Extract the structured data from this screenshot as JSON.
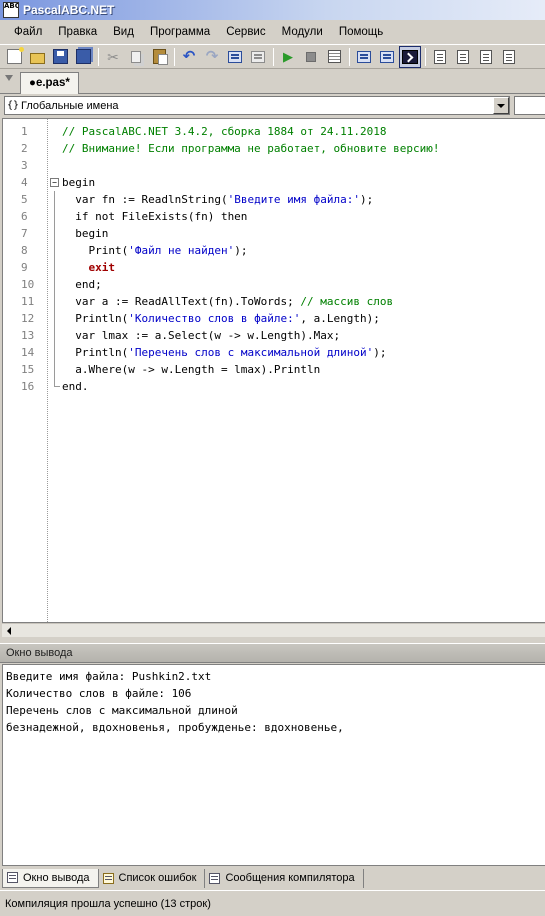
{
  "window": {
    "title": "PascalABC.NET",
    "icon_label": "ABC"
  },
  "menu": [
    "Файл",
    "Правка",
    "Вид",
    "Программа",
    "Сервис",
    "Модули",
    "Помощь"
  ],
  "toolbar": {
    "icons": [
      "new-file-icon",
      "open-icon",
      "save-icon",
      "save-all-icon",
      "cut-icon",
      "copy-icon",
      "paste-icon",
      "undo-icon",
      "redo-icon",
      "comment-icon",
      "uncomment-icon",
      "run-icon",
      "stop-icon",
      "debug-window-icon",
      "step-into-icon",
      "step-over-icon",
      "console-icon",
      "form-icon",
      "module-icon",
      "unit-icon",
      "doc-icon"
    ],
    "active": "console-icon"
  },
  "tab": {
    "label": "●e.pas*"
  },
  "scope": {
    "icon": "{}",
    "label": "Глобальные имена"
  },
  "code": {
    "lines": [
      {
        "n": "1",
        "parts": [
          {
            "t": "// PascalABC.NET 3.4.2, сборка 1884 от 24.11.2018",
            "c": "cm"
          }
        ]
      },
      {
        "n": "2",
        "parts": [
          {
            "t": "// Внимание! Если программа не работает, обновите версию!",
            "c": "cm"
          }
        ]
      },
      {
        "n": "3",
        "parts": []
      },
      {
        "n": "4",
        "parts": [
          {
            "t": "begin",
            "c": "kw"
          }
        ]
      },
      {
        "n": "5",
        "parts": [
          {
            "t": "  var fn := ReadlnString(",
            "c": "kw"
          },
          {
            "t": "'Введите имя файла:'",
            "c": "st"
          },
          {
            "t": ");",
            "c": "kw"
          }
        ]
      },
      {
        "n": "6",
        "parts": [
          {
            "t": "  if not FileExists(fn) then",
            "c": "kw"
          }
        ]
      },
      {
        "n": "7",
        "parts": [
          {
            "t": "  begin",
            "c": "kw"
          }
        ]
      },
      {
        "n": "8",
        "parts": [
          {
            "t": "    Print(",
            "c": "kw"
          },
          {
            "t": "'Файл не найден'",
            "c": "st"
          },
          {
            "t": ");",
            "c": "kw"
          }
        ]
      },
      {
        "n": "9",
        "parts": [
          {
            "t": "    ",
            "c": "kw"
          },
          {
            "t": "exit",
            "c": "ex"
          }
        ]
      },
      {
        "n": "10",
        "parts": [
          {
            "t": "  end;",
            "c": "kw"
          }
        ]
      },
      {
        "n": "11",
        "parts": [
          {
            "t": "  var a := ReadAllText(fn).ToWords; ",
            "c": "kw"
          },
          {
            "t": "// массив слов",
            "c": "cm"
          }
        ]
      },
      {
        "n": "12",
        "parts": [
          {
            "t": "  Println(",
            "c": "kw"
          },
          {
            "t": "'Количество слов в файле:'",
            "c": "st"
          },
          {
            "t": ", a.Length);",
            "c": "kw"
          }
        ]
      },
      {
        "n": "13",
        "parts": [
          {
            "t": "  var lmax := a.Select(w -> w.Length).Max;",
            "c": "kw"
          }
        ]
      },
      {
        "n": "14",
        "parts": [
          {
            "t": "  Println(",
            "c": "kw"
          },
          {
            "t": "'Перечень слов с максимальной длиной'",
            "c": "st"
          },
          {
            "t": ");",
            "c": "kw"
          }
        ]
      },
      {
        "n": "15",
        "parts": [
          {
            "t": "  a.Where(w -> w.Length = lmax).Println",
            "c": "kw"
          }
        ]
      },
      {
        "n": "16",
        "parts": [
          {
            "t": "end.",
            "c": "kw"
          }
        ]
      }
    ]
  },
  "output": {
    "title": "Окно вывода",
    "lines": [
      "Введите имя файла: Pushkin2.txt",
      "Количество слов в файле: 106",
      "Перечень слов с максимальной длиной",
      "безнадежной, вдохновенья, пробужденье: вдохновенье,"
    ]
  },
  "bottom_tabs": [
    {
      "label": "Окно вывода",
      "active": true
    },
    {
      "label": "Список ошибок",
      "active": false
    },
    {
      "label": "Сообщения компилятора",
      "active": false
    }
  ],
  "status": {
    "text": "Компиляция прошла успешно (13 строк)"
  }
}
